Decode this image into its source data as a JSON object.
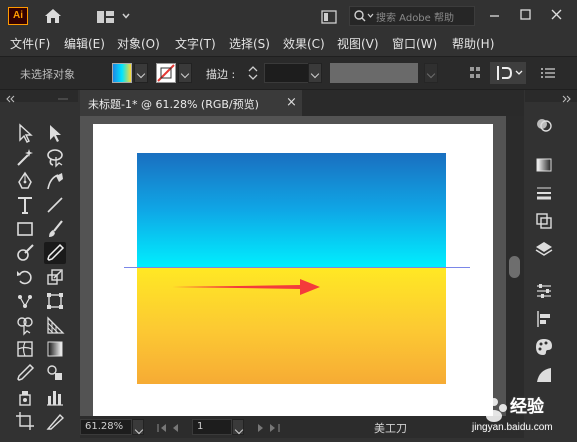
{
  "app": {
    "logo": "Ai"
  },
  "search": {
    "placeholder": "搜索 Adobe 帮助"
  },
  "menus": [
    "文件(F)",
    "编辑(E)",
    "对象(O)",
    "文字(T)",
    "选择(S)",
    "效果(C)",
    "视图(V)",
    "窗口(W)",
    "帮助(H)"
  ],
  "control_bar": {
    "selection_status": "未选择对象",
    "stroke_label": "描边",
    "stroke_colon": ":"
  },
  "document": {
    "tab_label": "未标题-1* @ 61.28% (RGB/预览)",
    "close": "×"
  },
  "status_bar": {
    "zoom": "61.28%",
    "page": "1",
    "current_tool": "美工刀"
  },
  "watermark": {
    "site": "jingyan.baidu.com",
    "title": "经验"
  },
  "colors": {
    "arrow": "#f43b3b",
    "guide": "#7a86e8",
    "top_gradient_end": "#00f0ff",
    "bottom_gradient_top": "#ffe824"
  }
}
